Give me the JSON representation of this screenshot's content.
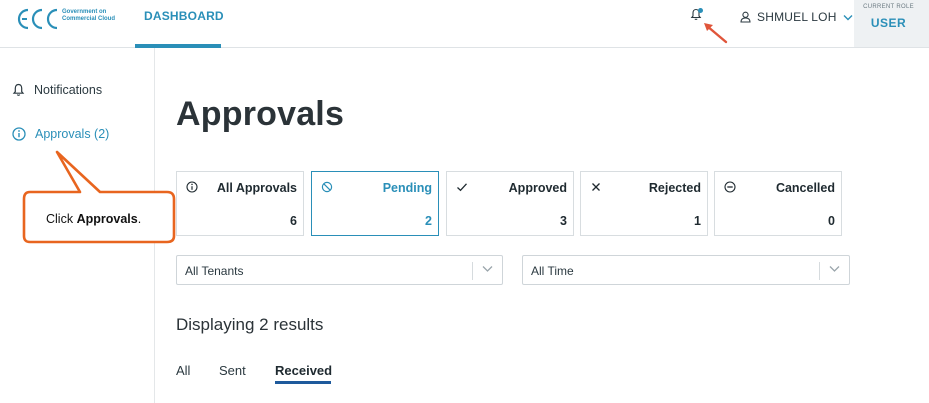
{
  "header": {
    "logo_letters": "GCC",
    "logo_line1": "Government on",
    "logo_line2": "Commercial Cloud",
    "nav_dashboard": "DASHBOARD",
    "user_name": "SHMUEL LOH",
    "role_caption": "CURRENT ROLE",
    "role_value": "USER"
  },
  "sidebar": {
    "items": [
      {
        "label": "Notifications",
        "icon": "bell-icon"
      },
      {
        "label": "Approvals (2)",
        "icon": "info-circle-icon"
      }
    ]
  },
  "callout": {
    "prefix": "Click ",
    "bold": "Approvals",
    "suffix": "."
  },
  "main": {
    "title": "Approvals",
    "cards": [
      {
        "label": "All Approvals",
        "count": "6",
        "icon": "info-circle-icon"
      },
      {
        "label": "Pending",
        "count": "2",
        "icon": "ban-icon",
        "active": true
      },
      {
        "label": "Approved",
        "count": "3",
        "icon": "check-icon"
      },
      {
        "label": "Rejected",
        "count": "1",
        "icon": "x-icon"
      },
      {
        "label": "Cancelled",
        "count": "0",
        "icon": "minus-circle-icon"
      }
    ],
    "filters": {
      "tenant": "All Tenants",
      "time": "All Time"
    },
    "results_text": "Displaying 2 results",
    "tabs": [
      "All",
      "Sent",
      "Received"
    ],
    "active_tab": "Received"
  },
  "colors": {
    "accent": "#2a8fb8",
    "callout_border": "#e8651f",
    "annotation_arrow": "#e0553a",
    "tab_underline": "#1e5a9c"
  }
}
